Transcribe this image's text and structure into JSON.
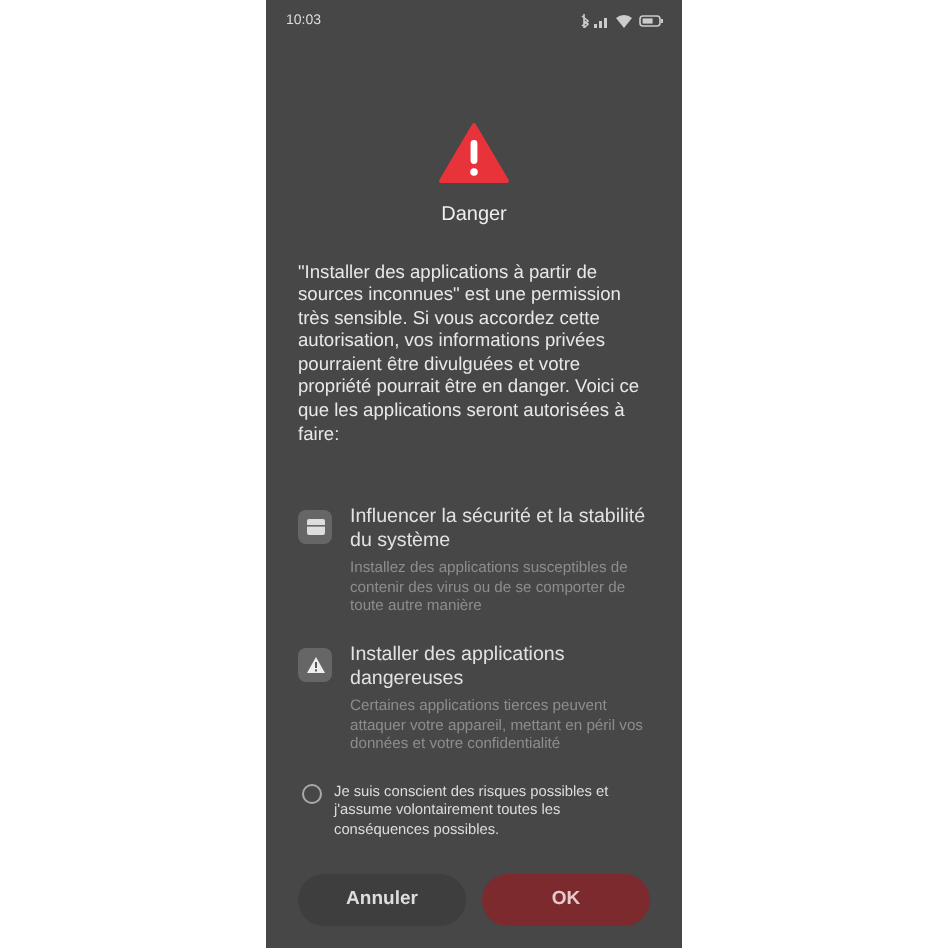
{
  "status_bar": {
    "time": "10:03"
  },
  "dialog": {
    "title": "Danger",
    "message": "\"Installer des applications à partir de sources inconnues\" est une permission très sensible. Si vous accordez cette autorisation, vos informations privées pourraient être divulguées et votre propriété pourrait être en danger. Voici ce que les applications seront autorisées à faire:",
    "permissions": [
      {
        "kind": "system",
        "title": "Influencer la sécurité et la stabilité du système",
        "description": "Installez des applications susceptibles de contenir des virus ou de se comporter de toute autre manière"
      },
      {
        "kind": "warning",
        "title": "Installer des applications dangereuses",
        "description": "Certaines applications tierces peuvent attaquer votre appareil, mettant en péril vos données et votre confidentialité"
      }
    ],
    "consent": {
      "label": "Je suis conscient des risques possibles et j'assume volontairement toutes les conséquences possibles.",
      "checked": false
    },
    "buttons": [
      {
        "label": "Annuler",
        "kind": "cancel"
      },
      {
        "label": "OK",
        "kind": "confirm"
      }
    ]
  }
}
